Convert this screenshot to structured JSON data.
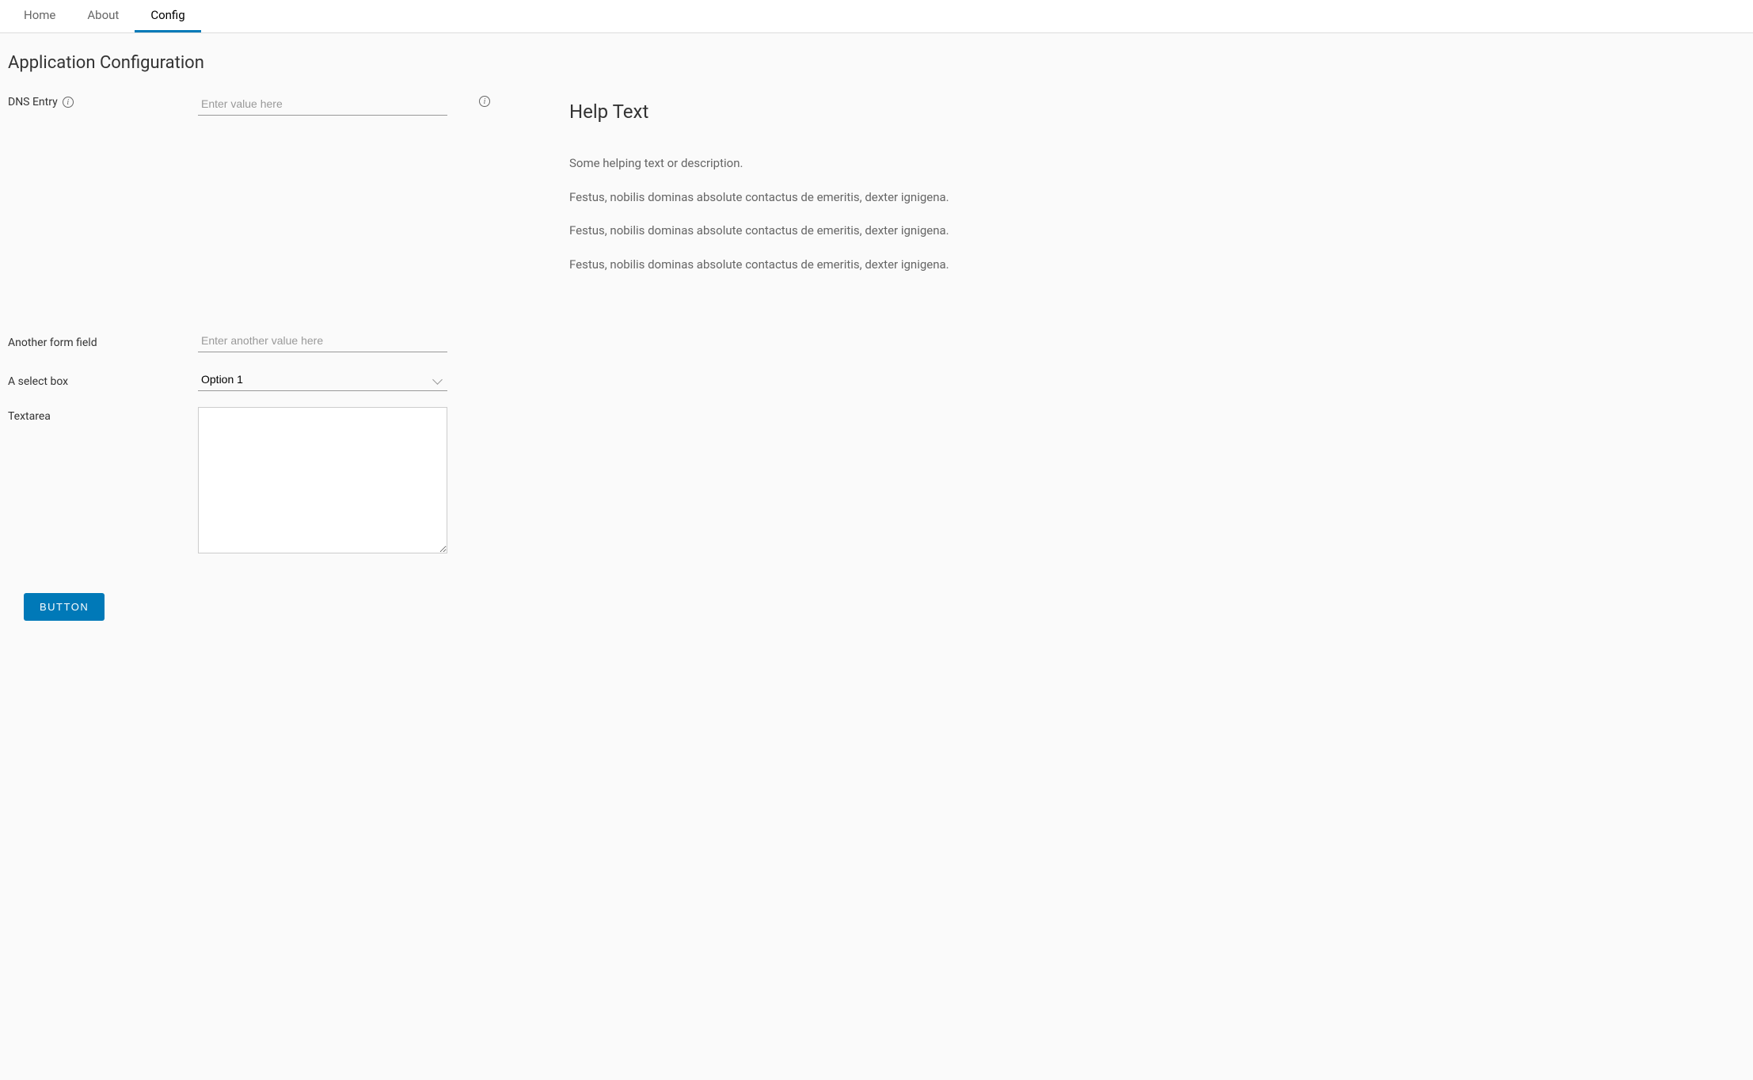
{
  "tabs": [
    {
      "label": "Home",
      "active": false
    },
    {
      "label": "About",
      "active": false
    },
    {
      "label": "Config",
      "active": true
    }
  ],
  "page": {
    "title": "Application Configuration"
  },
  "form": {
    "dns": {
      "label": "DNS Entry",
      "placeholder": "Enter value here"
    },
    "another": {
      "label": "Another form field",
      "placeholder": "Enter another value here"
    },
    "select": {
      "label": "A select box",
      "selected": "Option 1"
    },
    "textarea": {
      "label": "Textarea",
      "value": ""
    },
    "button": {
      "label": "BUTTON"
    }
  },
  "help": {
    "title": "Help Text",
    "paragraphs": [
      "Some helping text or description.",
      "Festus, nobilis dominas absolute contactus de emeritis, dexter ignigena.",
      "Festus, nobilis dominas absolute contactus de emeritis, dexter ignigena.",
      "Festus, nobilis dominas absolute contactus de emeritis, dexter ignigena."
    ]
  }
}
